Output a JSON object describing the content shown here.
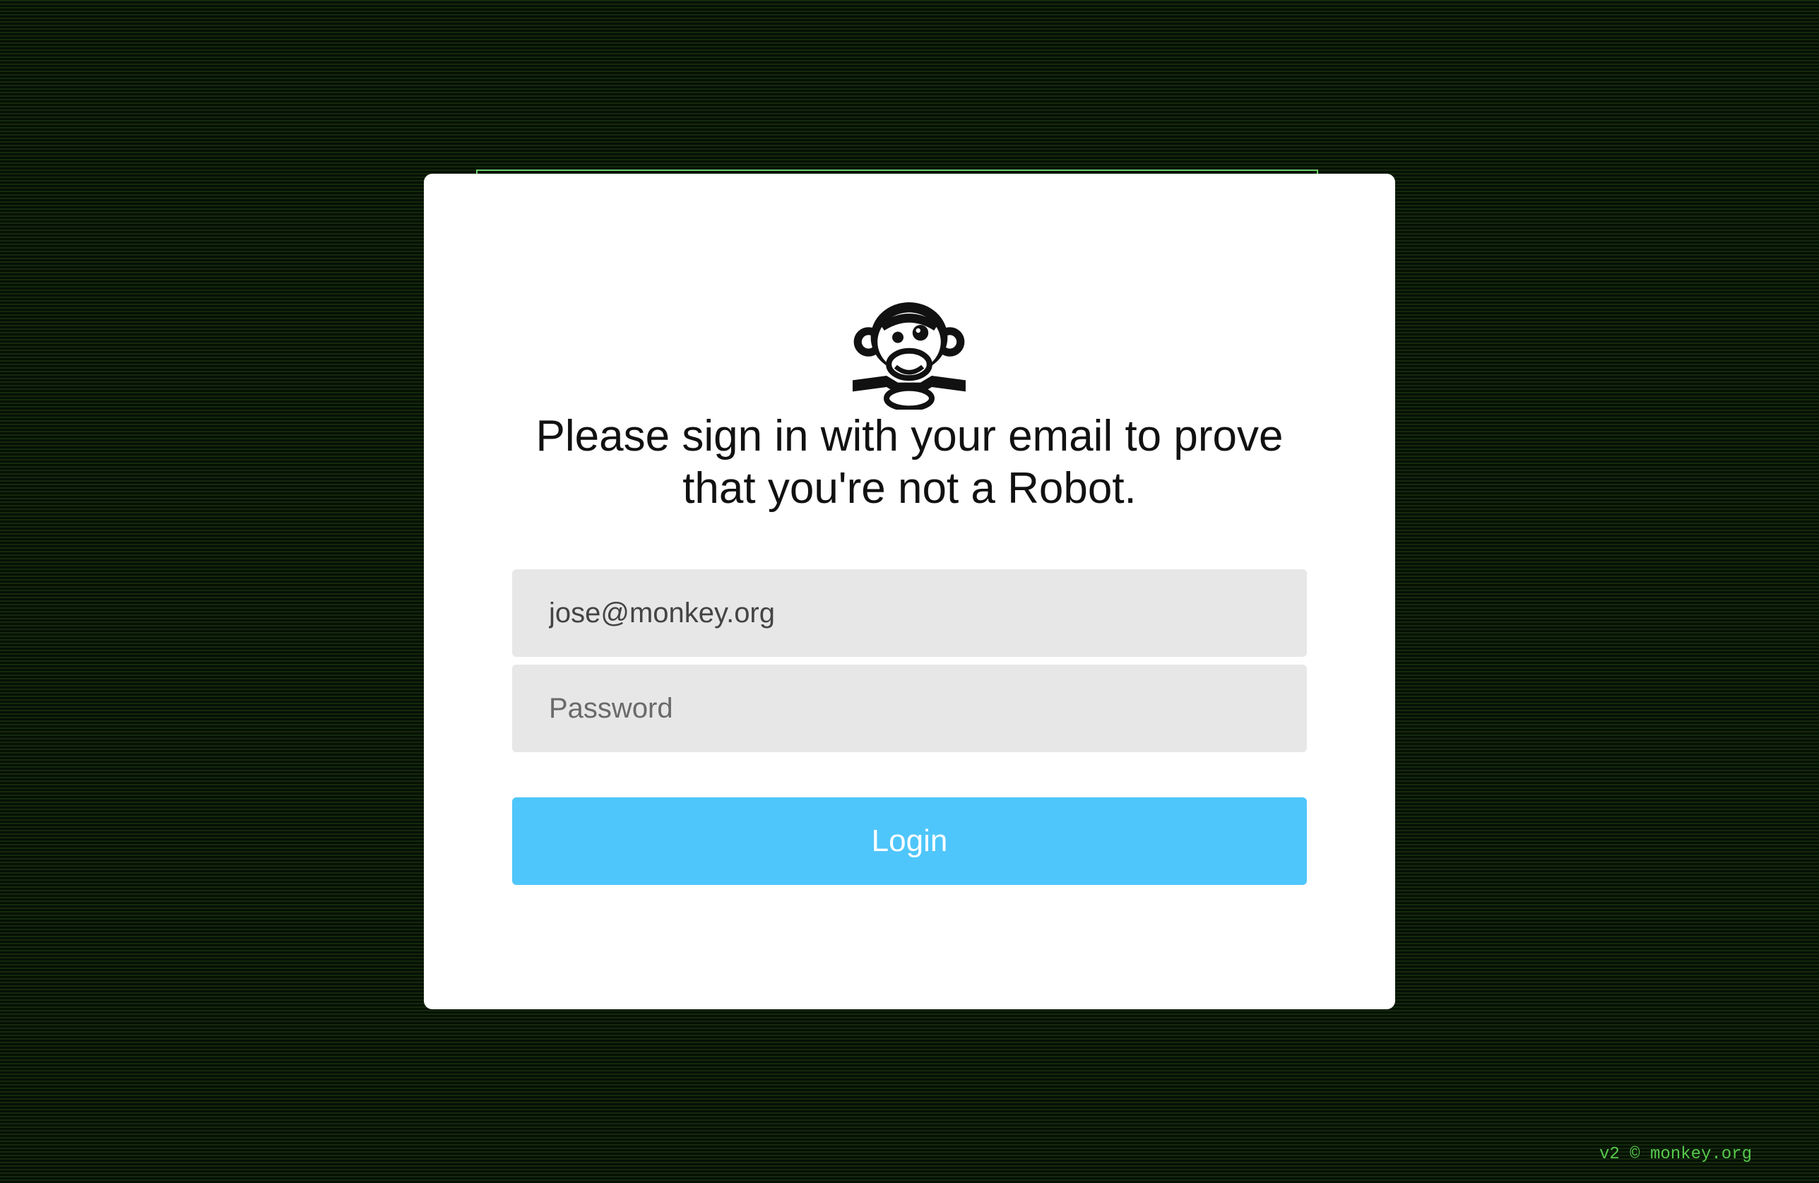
{
  "login": {
    "headline_line1": "Please sign in with your email to prove",
    "headline_line2": "that you're not a Robot.",
    "email_value": "jose@monkey.org",
    "password_placeholder": "Password",
    "button_label": "Login"
  },
  "logo": {
    "icon": "monkey-logo-icon"
  },
  "footer": {
    "text": "v2 © monkey.org"
  },
  "colors": {
    "background": "#0b1a07",
    "card": "#ffffff",
    "field": "#e7e7e7",
    "button": "#4fc6fb",
    "footer_text": "#55c94b"
  }
}
